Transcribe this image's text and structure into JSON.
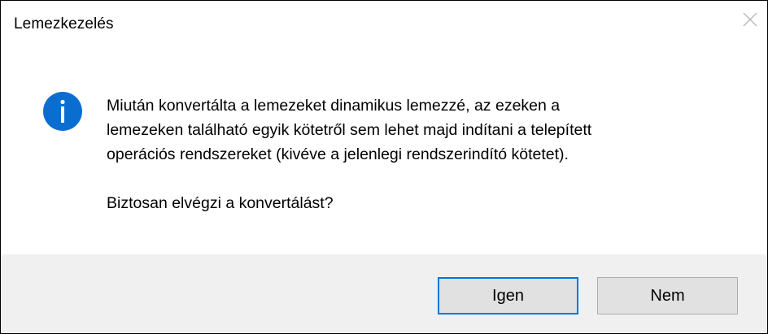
{
  "window": {
    "title": "Lemezkezelés",
    "close_icon": "close-icon"
  },
  "message": {
    "icon": "info-icon",
    "icon_color": "#0a6ed1",
    "text": "Miután konvertálta a lemezeket dinamikus lemezzé, az ezeken a\nlemezeken található egyik kötetről sem lehet majd indítani a telepített\noperációs rendszereket (kivéve a jelenlegi rendszerindító kötetet).",
    "question": "Biztosan elvégzi a konvertálást?"
  },
  "buttons": {
    "yes_label": "Igen",
    "no_label": "Nem"
  },
  "colors": {
    "footer_bg": "#f0f0f0",
    "primary_border": "#0078d7",
    "button_bg": "#e1e1e1"
  }
}
